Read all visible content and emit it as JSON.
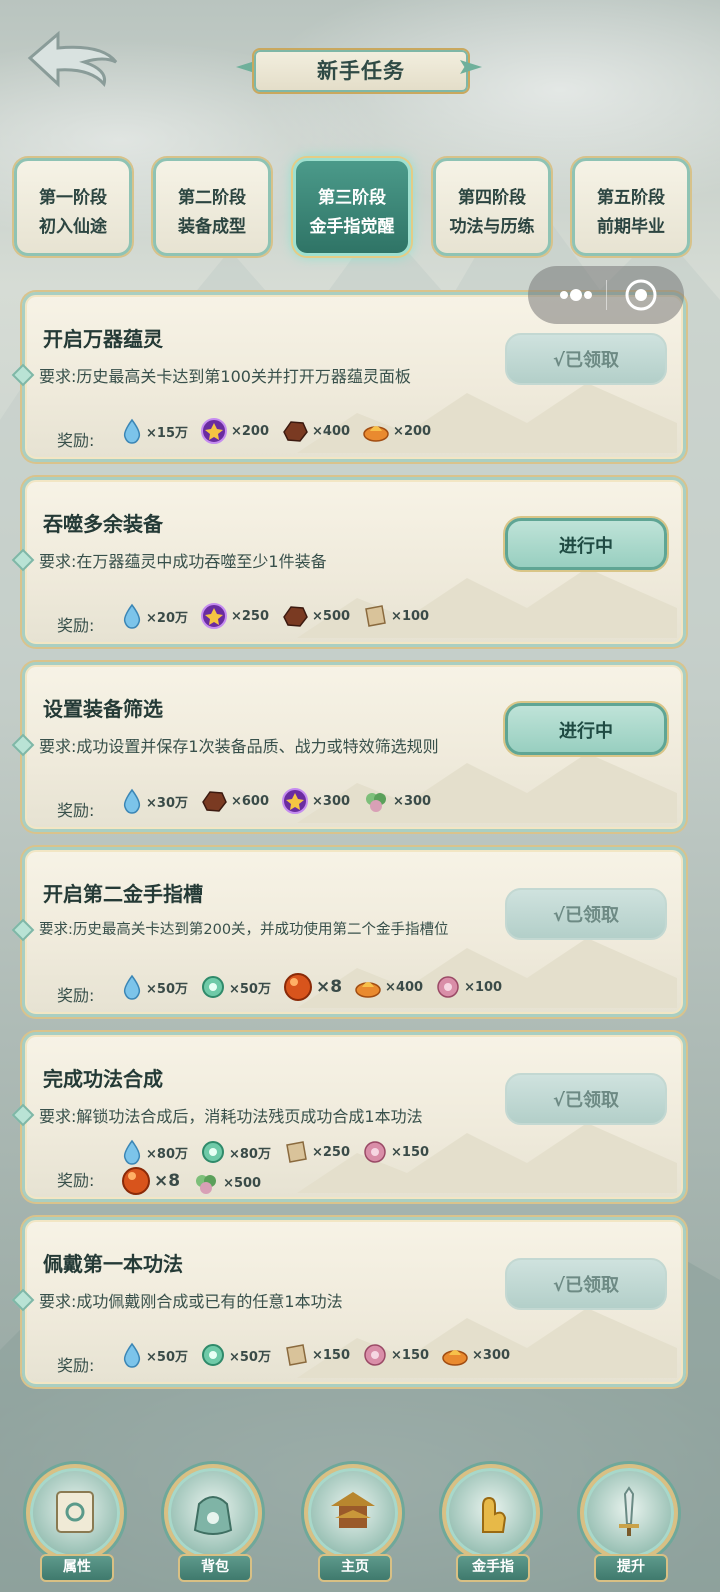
{
  "header": {
    "title": "新手任务"
  },
  "tabs": [
    {
      "line1": "第一阶段",
      "line2": "初入仙途",
      "active": false
    },
    {
      "line1": "第二阶段",
      "line2": "装备成型",
      "active": false
    },
    {
      "line1": "第三阶段",
      "line2": "金手指觉醒",
      "active": true
    },
    {
      "line1": "第四阶段",
      "line2": "功法与历练",
      "active": false
    },
    {
      "line1": "第五阶段",
      "line2": "前期毕业",
      "active": false
    }
  ],
  "reward_label": "奖励:",
  "tasks": [
    {
      "name": "开启万器蕴灵",
      "req": "要求:历史最高关卡达到第100关并打开万器蕴灵面板",
      "button": "√已领取",
      "rewards": [
        "×15万",
        "×200",
        "×400",
        "×200"
      ]
    },
    {
      "name": "吞噬多余装备",
      "req": "要求:在万器蕴灵中成功吞噬至少1件装备",
      "button": "进行中",
      "rewards": [
        "×20万",
        "×250",
        "×500",
        "×100"
      ]
    },
    {
      "name": "设置装备筛选",
      "req": "要求:成功设置并保存1次装备品质、战力或特效筛选规则",
      "button": "进行中",
      "rewards": [
        "×30万",
        "×600",
        "×300",
        "×300"
      ]
    },
    {
      "name": "开启第二金手指槽",
      "req": "要求:历史最高关卡达到第200关，并成功使用第二个金手指槽位",
      "button": "√已领取",
      "rewards": [
        "×50万",
        "×50万",
        "×8",
        "×400",
        "×100"
      ]
    },
    {
      "name": "完成功法合成",
      "req": "要求:解锁功法合成后，消耗功法残页成功合成1本功法",
      "button": "√已领取",
      "rewards": [
        "×80万",
        "×80万",
        "×250",
        "×150",
        "×8",
        "×500"
      ]
    },
    {
      "name": "佩戴第一本功法",
      "req": "要求:成功佩戴刚合成或已有的任意1本功法",
      "button": "√已领取",
      "rewards": [
        "×50万",
        "×50万",
        "×150",
        "×150",
        "×300"
      ]
    }
  ],
  "nav": [
    {
      "label": "属性",
      "icon": "scroll-icon"
    },
    {
      "label": "背包",
      "icon": "bag-icon"
    },
    {
      "label": "主页",
      "icon": "pavilion-icon"
    },
    {
      "label": "金手指",
      "icon": "golden-finger-icon"
    },
    {
      "label": "提升",
      "icon": "sword-icon"
    }
  ],
  "colors": {
    "accent": "#3f7a6d",
    "gold": "#d8c084",
    "text": "#243a36"
  }
}
